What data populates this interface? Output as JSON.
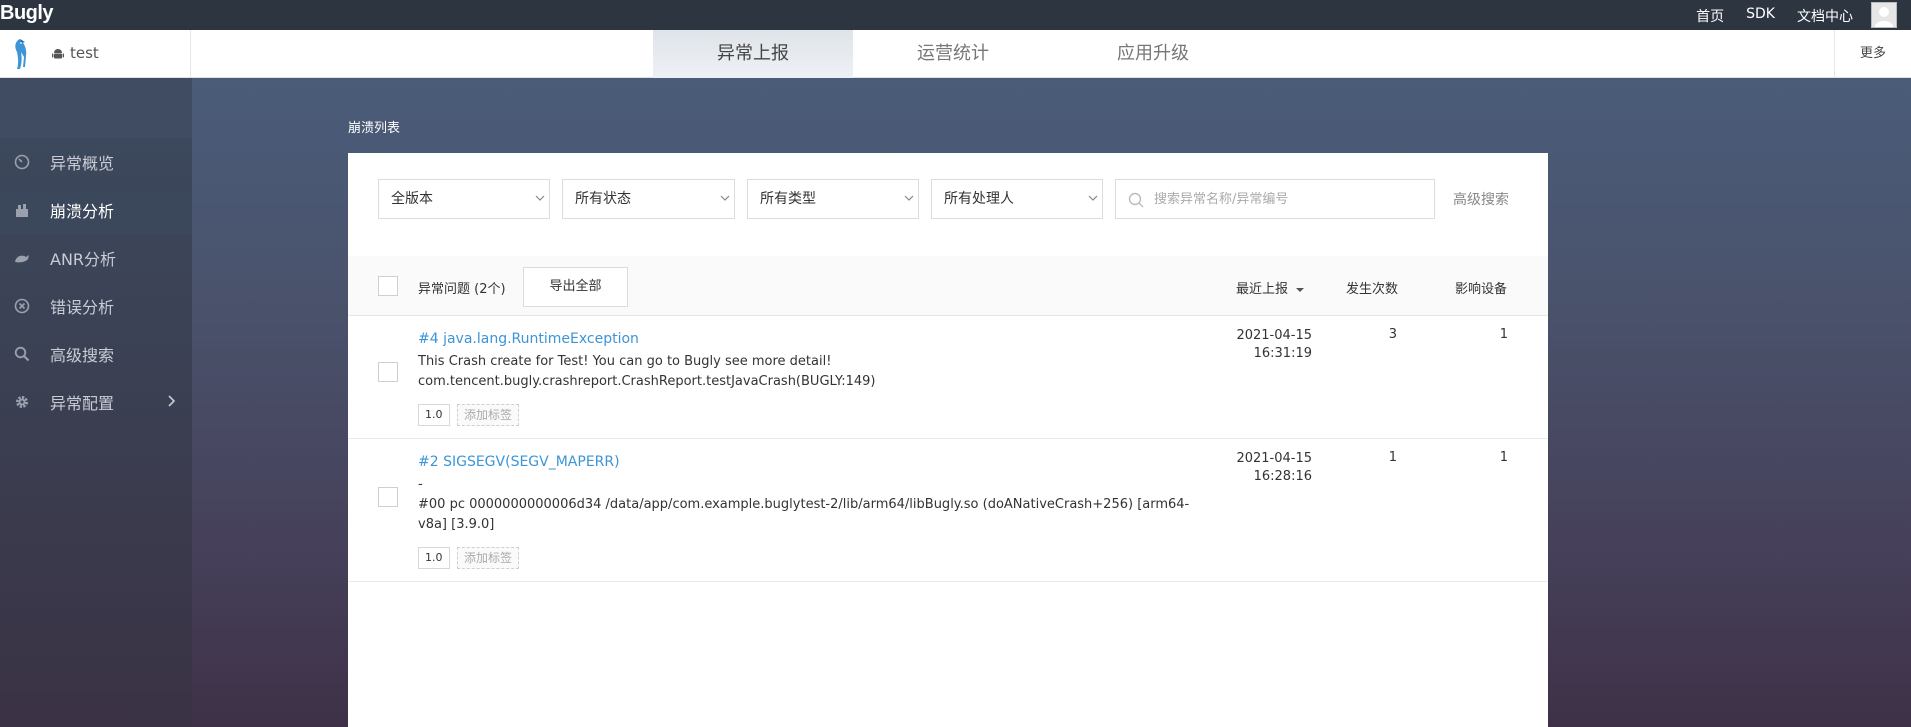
{
  "topbar": {
    "brand": "Bugly",
    "links": [
      "首页",
      "SDK",
      "文档中心"
    ]
  },
  "header": {
    "app_name": "test",
    "tabs": [
      {
        "label": "异常上报",
        "active": true
      },
      {
        "label": "运营统计",
        "active": false
      },
      {
        "label": "应用升级",
        "active": false
      }
    ],
    "more": "更多"
  },
  "sidebar": {
    "items": [
      {
        "label": "异常概览",
        "icon": "dashboard-icon"
      },
      {
        "label": "崩溃分析",
        "icon": "crash-icon",
        "active": true
      },
      {
        "label": "ANR分析",
        "icon": "anr-icon"
      },
      {
        "label": "错误分析",
        "icon": "error-icon"
      },
      {
        "label": "高级搜索",
        "icon": "search-icon"
      },
      {
        "label": "异常配置",
        "icon": "gear-icon"
      }
    ]
  },
  "main": {
    "section_title": "崩溃列表",
    "filters": {
      "version": "全版本",
      "status": "所有状态",
      "type": "所有类型",
      "handler": "所有处理人",
      "search_placeholder": "搜索异常名称/异常编号",
      "advanced": "高级搜索"
    },
    "list_header": {
      "title": "异常问题 (2个)",
      "export": "导出全部",
      "col_recent": "最近上报",
      "col_count": "发生次数",
      "col_devices": "影响设备"
    },
    "rows": [
      {
        "title": "#4 java.lang.RuntimeException",
        "line1": "This Crash create for Test! You can go to Bugly see more detail!",
        "line2": "com.tencent.bugly.crashreport.CrashReport.testJavaCrash(BUGLY:149)",
        "version": "1.0",
        "add_tag": "添加标签",
        "date": "2021-04-15",
        "time": "16:31:19",
        "count": "3",
        "devices": "1"
      },
      {
        "title": "#2 SIGSEGV(SEGV_MAPERR)",
        "line1": "-",
        "line2": "#00 pc 0000000000006d34 /data/app/com.example.buglytest-2/lib/arm64/libBugly.so (doANativeCrash+256) [arm64-",
        "line3": "v8a] [3.9.0]",
        "version": "1.0",
        "add_tag": "添加标签",
        "date": "2021-04-15",
        "time": "16:28:16",
        "count": "1",
        "devices": "1"
      }
    ]
  },
  "colors": {
    "topbar": "#2c3540",
    "link": "#3c95d6",
    "sidebar_active": "#3b475a"
  }
}
